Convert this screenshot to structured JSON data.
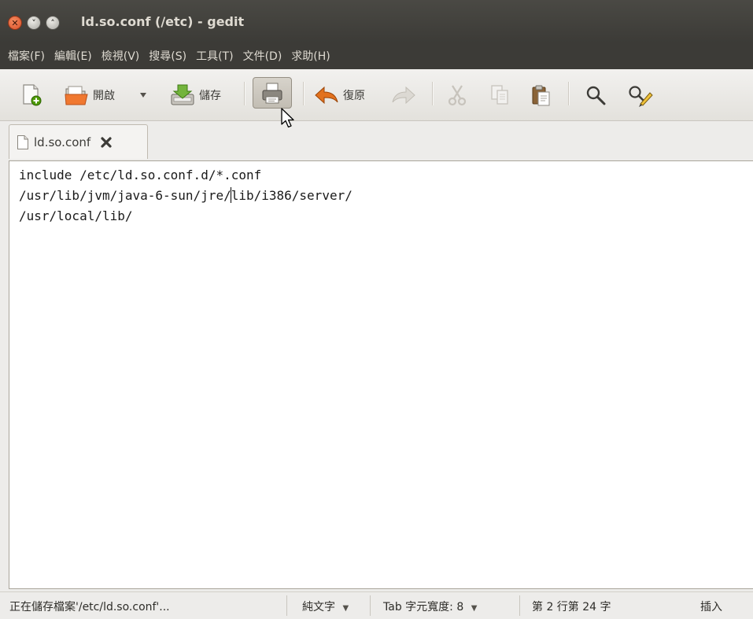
{
  "window": {
    "title": "ld.so.conf (/etc) - gedit"
  },
  "menubar": {
    "items": [
      "檔案(F)",
      "編輯(E)",
      "檢視(V)",
      "搜尋(S)",
      "工具(T)",
      "文件(D)",
      "求助(H)"
    ]
  },
  "toolbar": {
    "open_label": "開啟",
    "save_label": "儲存",
    "undo_label": "復原"
  },
  "tab": {
    "label": "ld.so.conf"
  },
  "editor": {
    "lines": [
      "include /etc/ld.so.conf.d/*.conf",
      "/usr/lib/jvm/java-6-sun/jre/lib/i386/server/",
      "/usr/local/lib/"
    ]
  },
  "statusbar": {
    "message": "正在儲存檔案'/etc/ld.so.conf'...",
    "language": "純文字",
    "tab_width": "Tab 字元寬度: 8",
    "position": "第 2 行第 24 字",
    "mode": "插入",
    "dropdown_glyph": "▼"
  },
  "icons": {
    "close": "close-icon",
    "minimize": "minimize-icon",
    "maximize": "maximize-icon"
  },
  "colors": {
    "titlebar": "#3c3b37",
    "accent_close": "#e0603a",
    "undo_arrow": "#e2711d"
  }
}
